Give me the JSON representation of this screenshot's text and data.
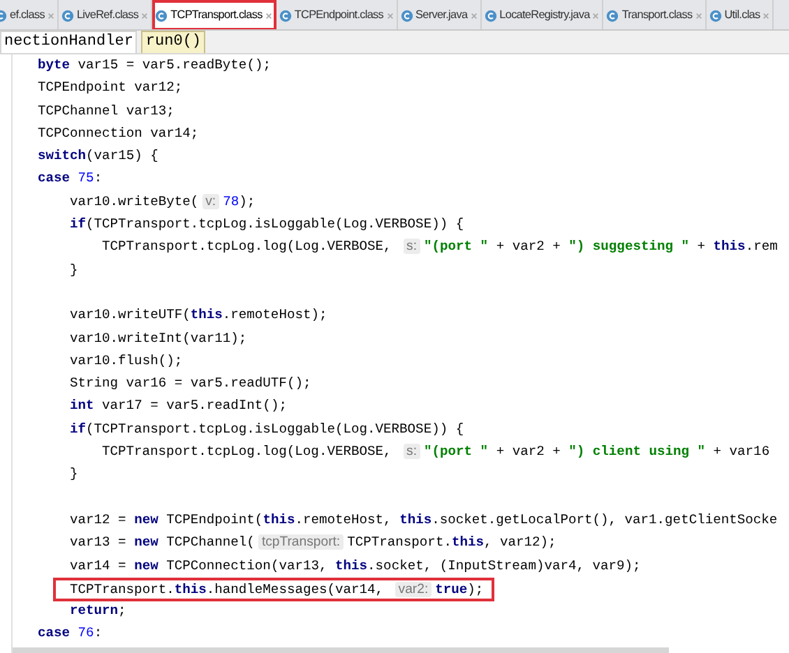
{
  "tabs": [
    {
      "label": "ef.class",
      "selected": false,
      "highlighted": false
    },
    {
      "label": "LiveRef.class",
      "selected": false,
      "highlighted": false
    },
    {
      "label": "TCPTransport.class",
      "selected": true,
      "highlighted": true
    },
    {
      "label": "TCPEndpoint.class",
      "selected": false,
      "highlighted": false
    },
    {
      "label": "Server.java",
      "selected": false,
      "highlighted": false
    },
    {
      "label": "LocateRegistry.java",
      "selected": false,
      "highlighted": false
    },
    {
      "label": "Transport.class",
      "selected": false,
      "highlighted": false
    },
    {
      "label": "Util.clas",
      "selected": false,
      "highlighted": false
    }
  ],
  "breadcrumb": [
    {
      "label": "nectionHandler",
      "selected": false
    },
    {
      "label": "run0()",
      "selected": true
    }
  ],
  "code_lines": [
    {
      "highlighted": false,
      "tokens": [
        {
          "kind": "keyword",
          "text": "byte"
        },
        {
          "kind": "plain",
          "text": " var15 = var5.readByte();"
        }
      ]
    },
    {
      "highlighted": false,
      "tokens": [
        {
          "kind": "plain",
          "text": "TCPEndpoint var12;"
        }
      ]
    },
    {
      "highlighted": false,
      "tokens": [
        {
          "kind": "plain",
          "text": "TCPChannel var13;"
        }
      ]
    },
    {
      "highlighted": false,
      "tokens": [
        {
          "kind": "plain",
          "text": "TCPConnection var14;"
        }
      ]
    },
    {
      "highlighted": false,
      "tokens": [
        {
          "kind": "keyword",
          "text": "switch"
        },
        {
          "kind": "plain",
          "text": "(var15) {"
        }
      ]
    },
    {
      "highlighted": false,
      "tokens": [
        {
          "kind": "keyword",
          "text": "case "
        },
        {
          "kind": "number",
          "text": "75"
        },
        {
          "kind": "plain",
          "text": ":"
        }
      ],
      "groups": [
        {
          "lines": [
            {
              "highlighted": false,
              "tokens": [
                {
                  "kind": "plain",
                  "text": "var10.writeByte("
                },
                {
                  "kind": "hint",
                  "text": "v:"
                },
                {
                  "kind": "number",
                  "text": "78"
                },
                {
                  "kind": "plain",
                  "text": ");"
                }
              ]
            },
            {
              "highlighted": false,
              "tokens": [
                {
                  "kind": "keyword",
                  "text": "if"
                },
                {
                  "kind": "plain",
                  "text": "(TCPTransport.tcpLog.isLoggable(Log.VERBOSE)) {"
                }
              ],
              "children": [
                {
                  "highlighted": false,
                  "tokens": [
                    {
                      "kind": "plain",
                      "text": "TCPTransport.tcpLog.log(Log.VERBOSE, "
                    },
                    {
                      "kind": "hint",
                      "text": "s:"
                    },
                    {
                      "kind": "string",
                      "text": "\"(port \""
                    },
                    {
                      "kind": "plain",
                      "text": " + var2 + "
                    },
                    {
                      "kind": "string",
                      "text": "\") suggesting \""
                    },
                    {
                      "kind": "plain",
                      "text": " + "
                    },
                    {
                      "kind": "keyword",
                      "text": "this"
                    },
                    {
                      "kind": "plain",
                      "text": ".rem"
                    }
                  ]
                }
              ]
            },
            {
              "highlighted": false,
              "tokens": [
                {
                  "kind": "plain",
                  "text": "}"
                }
              ]
            }
          ]
        },
        {
          "lines": [
            {
              "highlighted": false,
              "tokens": [
                {
                  "kind": "plain",
                  "text": "var10.writeUTF("
                },
                {
                  "kind": "keyword",
                  "text": "this"
                },
                {
                  "kind": "plain",
                  "text": ".remoteHost);"
                }
              ]
            },
            {
              "highlighted": false,
              "tokens": [
                {
                  "kind": "plain",
                  "text": "var10.writeInt(var11);"
                }
              ]
            },
            {
              "highlighted": false,
              "tokens": [
                {
                  "kind": "plain",
                  "text": "var10.flush();"
                }
              ]
            },
            {
              "highlighted": false,
              "tokens": [
                {
                  "kind": "plain",
                  "text": "String var16 = var5.readUTF();"
                }
              ]
            },
            {
              "highlighted": false,
              "tokens": [
                {
                  "kind": "keyword",
                  "text": "int"
                },
                {
                  "kind": "plain",
                  "text": " var17 = var5.readInt();"
                }
              ]
            },
            {
              "highlighted": false,
              "tokens": [
                {
                  "kind": "keyword",
                  "text": "if"
                },
                {
                  "kind": "plain",
                  "text": "(TCPTransport.tcpLog.isLoggable(Log.VERBOSE)) {"
                }
              ],
              "children": [
                {
                  "highlighted": false,
                  "tokens": [
                    {
                      "kind": "plain",
                      "text": "TCPTransport.tcpLog.log(Log.VERBOSE, "
                    },
                    {
                      "kind": "hint",
                      "text": "s:"
                    },
                    {
                      "kind": "string",
                      "text": "\"(port \""
                    },
                    {
                      "kind": "plain",
                      "text": " + var2 + "
                    },
                    {
                      "kind": "string",
                      "text": "\") client using \""
                    },
                    {
                      "kind": "plain",
                      "text": " + var16"
                    }
                  ]
                }
              ]
            },
            {
              "highlighted": false,
              "tokens": [
                {
                  "kind": "plain",
                  "text": "}"
                }
              ]
            }
          ]
        },
        {
          "lines": [
            {
              "highlighted": false,
              "tokens": [
                {
                  "kind": "plain",
                  "text": "var12 = "
                },
                {
                  "kind": "keyword",
                  "text": "new"
                },
                {
                  "kind": "plain",
                  "text": " TCPEndpoint("
                },
                {
                  "kind": "keyword",
                  "text": "this"
                },
                {
                  "kind": "plain",
                  "text": ".remoteHost, "
                },
                {
                  "kind": "keyword",
                  "text": "this"
                },
                {
                  "kind": "plain",
                  "text": ".socket.getLocalPort(), var1.getClientSocke"
                }
              ]
            },
            {
              "highlighted": false,
              "tokens": [
                {
                  "kind": "plain",
                  "text": "var13 = "
                },
                {
                  "kind": "keyword",
                  "text": "new"
                },
                {
                  "kind": "plain",
                  "text": " TCPChannel("
                },
                {
                  "kind": "hint",
                  "text": "tcpTransport:"
                },
                {
                  "kind": "plain",
                  "text": "TCPTransport."
                },
                {
                  "kind": "keyword",
                  "text": "this"
                },
                {
                  "kind": "plain",
                  "text": ", var12);"
                }
              ]
            },
            {
              "highlighted": false,
              "tokens": [
                {
                  "kind": "plain",
                  "text": "var14 = "
                },
                {
                  "kind": "keyword",
                  "text": "new"
                },
                {
                  "kind": "plain",
                  "text": " TCPConnection(var13, "
                },
                {
                  "kind": "keyword",
                  "text": "this"
                },
                {
                  "kind": "plain",
                  "text": ".socket, (InputStream)var4, var9);"
                }
              ]
            },
            {
              "highlighted": true,
              "tokens": [
                {
                  "kind": "plain",
                  "text": "TCPTransport."
                },
                {
                  "kind": "keyword",
                  "text": "this"
                },
                {
                  "kind": "plain",
                  "text": ".handleMessages(var14, "
                },
                {
                  "kind": "hint",
                  "text": "var2:"
                },
                {
                  "kind": "keyword",
                  "text": "true"
                },
                {
                  "kind": "plain",
                  "text": ");"
                }
              ]
            },
            {
              "highlighted": false,
              "tokens": [
                {
                  "kind": "keyword",
                  "text": "return"
                },
                {
                  "kind": "plain",
                  "text": ";"
                }
              ]
            }
          ]
        }
      ]
    },
    {
      "highlighted": false,
      "tokens": [
        {
          "kind": "keyword",
          "text": "case "
        },
        {
          "kind": "number",
          "text": "76"
        },
        {
          "kind": "plain",
          "text": ":"
        }
      ]
    }
  ]
}
